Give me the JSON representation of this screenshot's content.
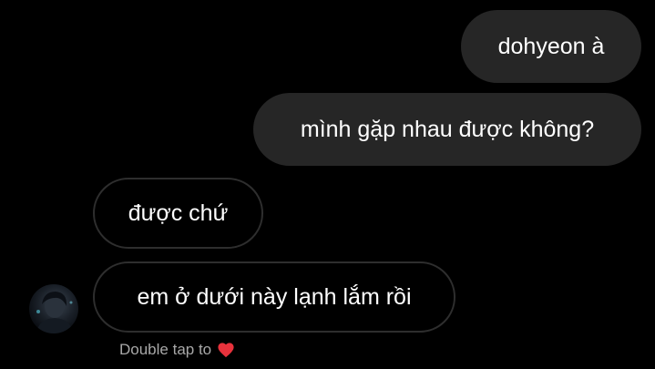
{
  "messages": [
    {
      "sender": "me",
      "text": "dohyeon à"
    },
    {
      "sender": "me",
      "text": "mình gặp nhau được không?"
    },
    {
      "sender": "them",
      "text": "được chứ"
    },
    {
      "sender": "them",
      "text": "em ở dưới này lạnh lắm rồi"
    }
  ],
  "reaction_hint": {
    "text": "Double tap to",
    "icon": "heart-icon",
    "icon_color": "#e8323c"
  },
  "colors": {
    "background": "#000000",
    "sent_bubble": "#262626",
    "received_bubble_border": "#2e2e2e",
    "text": "#ffffff",
    "hint_text": "#a8a8a8"
  }
}
